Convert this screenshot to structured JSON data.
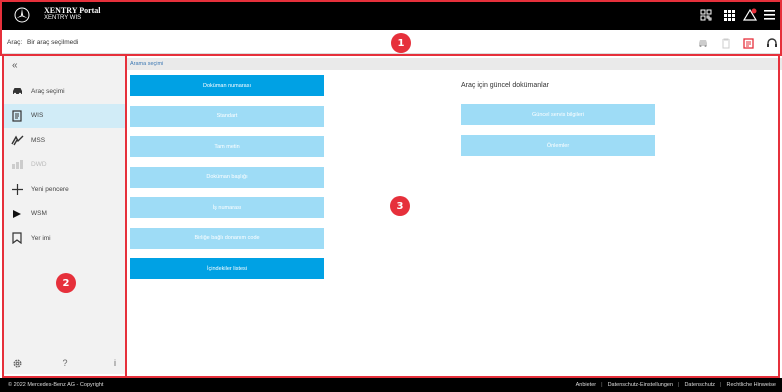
{
  "header": {
    "brand_title": "XENTRY Portal",
    "brand_subtitle": "XENTRY WIS",
    "icons": [
      "mercedes-star-icon",
      "qr-scan-icon",
      "grid-apps-icon",
      "warning-icon",
      "menu-icon"
    ],
    "warning_badge_color": "#e6303b"
  },
  "vehicle_bar": {
    "label": "Araç:",
    "value": "Bir araç seçilmedi",
    "icons": [
      "car-icon",
      "trash-icon",
      "document-icon",
      "headset-icon"
    ]
  },
  "sidebar": {
    "collapse_label": "«",
    "items": [
      {
        "label": "Araç seçimi",
        "icon": "car-icon",
        "state": "normal"
      },
      {
        "label": "WIS",
        "icon": "document-icon",
        "state": "active"
      },
      {
        "label": "MSS",
        "icon": "mss-icon",
        "state": "normal"
      },
      {
        "label": "DWD",
        "icon": "dwd-icon",
        "state": "disabled"
      },
      {
        "label": "Yeni pencere",
        "icon": "plus-icon",
        "state": "normal"
      },
      {
        "label": "WSM",
        "icon": "play-icon",
        "state": "normal"
      },
      {
        "label": "Yer imi",
        "icon": "bookmark-icon",
        "state": "normal"
      }
    ],
    "footer": {
      "settings_icon": "gear-icon",
      "help_label": "?",
      "info_label": "i"
    }
  },
  "main": {
    "section_title": "Arama seçimi",
    "search_buttons": [
      {
        "label": "Doküman numarası",
        "style": "primary"
      },
      {
        "label": "Standart",
        "style": "light"
      },
      {
        "label": "Tam metin",
        "style": "light"
      },
      {
        "label": "Doküman başlığı",
        "style": "light"
      },
      {
        "label": "İş numarası",
        "style": "light"
      },
      {
        "label": "Birliğe bağlı donanım code",
        "style": "light"
      },
      {
        "label": "İçindekiler listesi",
        "style": "primary"
      }
    ],
    "docs_heading": "Araç için güncel dokümanlar",
    "doc_buttons": [
      {
        "label": "Güncel servis bilgileri"
      },
      {
        "label": "Önlemler"
      }
    ]
  },
  "annotations": [
    {
      "number": "1",
      "target": "header"
    },
    {
      "number": "2",
      "target": "sidebar"
    },
    {
      "number": "3",
      "target": "main"
    }
  ],
  "footer": {
    "copyright": "© 2022 Mercedes-Benz AG - Copyright",
    "links": [
      "Anbieter",
      "Datenschutz-Einstellungen",
      "Datenschutz",
      "Rechtliche Hinweise"
    ]
  },
  "colors": {
    "primary_button": "#00a1e4",
    "light_button": "#9edcf6",
    "active_nav": "#d1ecf7",
    "annotation_red": "#e6303b"
  }
}
